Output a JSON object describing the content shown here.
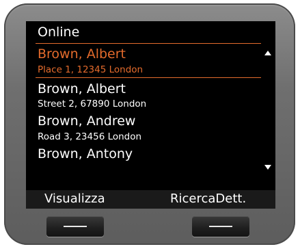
{
  "header": {
    "title": "Online"
  },
  "entries": [
    {
      "name": "Brown, Albert",
      "address": "Place 1, 12345 London"
    },
    {
      "name": "Brown, Albert",
      "address": "Street 2, 67890 London"
    },
    {
      "name": "Brown, Andrew",
      "address": "Road 3, 23456 London"
    },
    {
      "name": "Brown, Antony",
      "address": ""
    }
  ],
  "softkeys": {
    "left": "Visualizza",
    "right": "RicercaDett."
  },
  "icons": {
    "scroll_up": "triangle-up-icon",
    "scroll_down": "triangle-down-icon",
    "hardware_left": "minus-icon",
    "hardware_right": "minus-icon"
  },
  "colors": {
    "selected": "#e46b2c",
    "screen_bg": "#000000",
    "text": "#ffffff"
  }
}
